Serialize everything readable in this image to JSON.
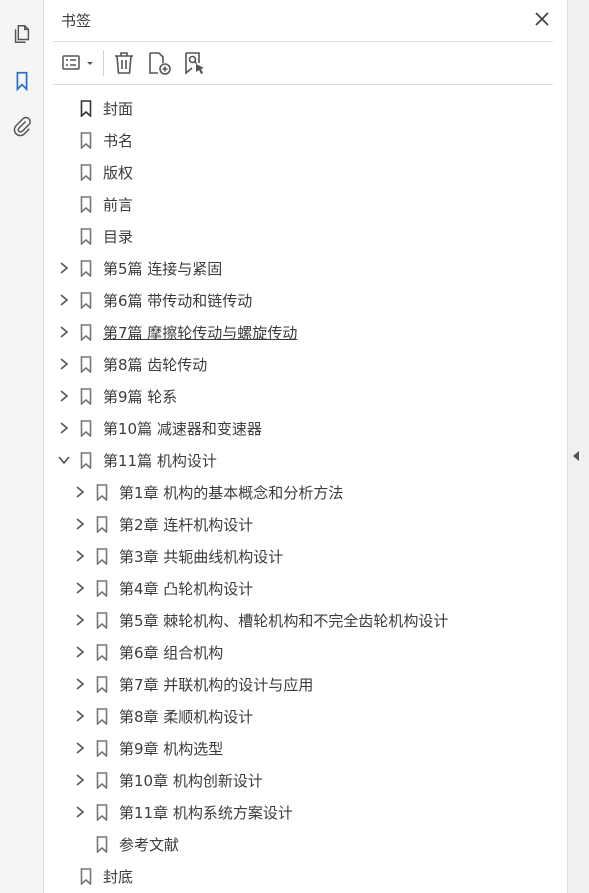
{
  "panel": {
    "title": "书签",
    "accent": "#2b6fcf"
  },
  "left_rail": {
    "icons": [
      "pages-icon",
      "bookmark-icon",
      "attachment-icon"
    ]
  },
  "toolbar": {
    "tools": [
      "options-menu-icon",
      "delete-icon",
      "new-bookmark-icon",
      "find-bookmark-icon"
    ]
  },
  "bookmarks": [
    {
      "label": "封面",
      "level": 0,
      "expander": "none",
      "emphasis": "dark"
    },
    {
      "label": "书名",
      "level": 0,
      "expander": "none"
    },
    {
      "label": "版权",
      "level": 0,
      "expander": "none"
    },
    {
      "label": "前言",
      "level": 0,
      "expander": "none"
    },
    {
      "label": "目录",
      "level": 0,
      "expander": "none"
    },
    {
      "label": "第5篇  连接与紧固",
      "level": 0,
      "expander": "collapsed"
    },
    {
      "label": "第6篇  带传动和链传动",
      "level": 0,
      "expander": "collapsed"
    },
    {
      "label": "第7篇  摩擦轮传动与螺旋传动",
      "level": 0,
      "expander": "collapsed",
      "underlined": true
    },
    {
      "label": "第8篇  齿轮传动",
      "level": 0,
      "expander": "collapsed"
    },
    {
      "label": "第9篇  轮系",
      "level": 0,
      "expander": "collapsed"
    },
    {
      "label": "第10篇  减速器和变速器",
      "level": 0,
      "expander": "collapsed"
    },
    {
      "label": "第11篇  机构设计",
      "level": 0,
      "expander": "expanded"
    },
    {
      "label": "第1章  机构的基本概念和分析方法",
      "level": 1,
      "expander": "collapsed"
    },
    {
      "label": "第2章  连杆机构设计",
      "level": 1,
      "expander": "collapsed"
    },
    {
      "label": "第3章  共轭曲线机构设计",
      "level": 1,
      "expander": "collapsed"
    },
    {
      "label": "第4章  凸轮机构设计",
      "level": 1,
      "expander": "collapsed"
    },
    {
      "label": "第5章  棘轮机构、槽轮机构和不完全齿轮机构设计",
      "level": 1,
      "expander": "collapsed"
    },
    {
      "label": "第6章  组合机构",
      "level": 1,
      "expander": "collapsed"
    },
    {
      "label": "第7章  并联机构的设计与应用",
      "level": 1,
      "expander": "collapsed"
    },
    {
      "label": "第8章  柔顺机构设计",
      "level": 1,
      "expander": "collapsed"
    },
    {
      "label": "第9章  机构选型",
      "level": 1,
      "expander": "collapsed"
    },
    {
      "label": "第10章  机构创新设计",
      "level": 1,
      "expander": "collapsed"
    },
    {
      "label": "第11章  机构系统方案设计",
      "level": 1,
      "expander": "collapsed"
    },
    {
      "label": "参考文献",
      "level": 1,
      "expander": "none"
    },
    {
      "label": "封底",
      "level": 0,
      "expander": "none"
    }
  ]
}
